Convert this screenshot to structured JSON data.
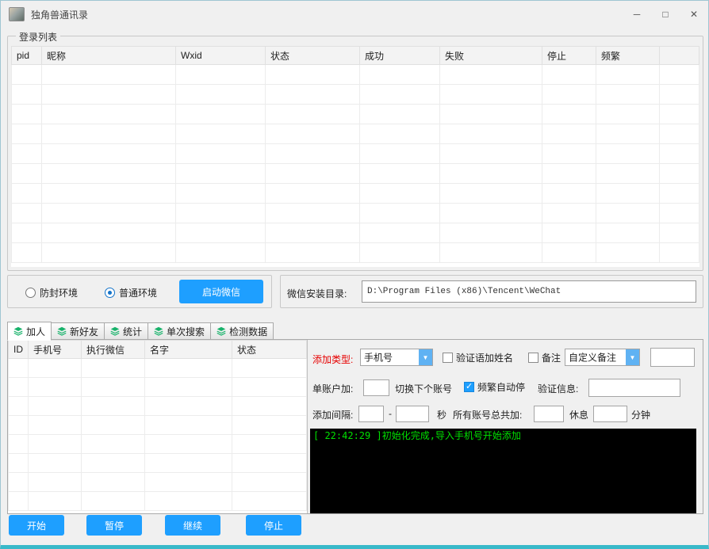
{
  "titlebar": {
    "title": "独角兽通讯录",
    "minimize": "─",
    "maximize": "□",
    "close": "✕"
  },
  "icons": {
    "dropdown_arrow": "▼",
    "check": "✓"
  },
  "login": {
    "group_title": "登录列表",
    "columns": [
      "pid",
      "昵称",
      "Wxid",
      "状态",
      "成功",
      "失败",
      "停止",
      "频繁"
    ]
  },
  "env": {
    "anti_ban": "防封环境",
    "normal": "普通环境",
    "selected": "普通环境",
    "start_button": "启动微信"
  },
  "install": {
    "label": "微信安装目录:",
    "path": "D:\\Program Files (x86)\\Tencent\\WeChat"
  },
  "tabs": [
    {
      "label": "加人",
      "active": true
    },
    {
      "label": "新好友",
      "active": false
    },
    {
      "label": "统计",
      "active": false
    },
    {
      "label": "单次搜索",
      "active": false
    },
    {
      "label": "检测数据",
      "active": false
    }
  ],
  "phone_table": {
    "columns": [
      "ID",
      "手机号",
      "执行微信",
      "名字",
      "状态"
    ]
  },
  "form": {
    "add_type_label": "添加类型:",
    "add_type_value": "手机号",
    "verify_with_name": "验证语加姓名",
    "remark": "备注",
    "remark_mode": "自定义备注",
    "custom_remark_value": "",
    "per_account_label": "单账户加:",
    "per_account_value": "",
    "switch_account": "切换下个账号",
    "auto_stop": "频繁自动停",
    "verify_msg_label": "验证信息:",
    "verify_msg_value": "",
    "interval_label": "添加间隔:",
    "interval_from": "",
    "interval_dash": "-",
    "interval_to": "",
    "seconds": "秒",
    "total_label": "所有账号总共加:",
    "total_value": "",
    "rest": "休息",
    "rest_value": "",
    "minutes": "分钟"
  },
  "console": {
    "lines": [
      "[ 22:42:29 ]初始化完成,导入手机号开始添加"
    ]
  },
  "actions": {
    "start": "开始",
    "pause": "暂停",
    "resume": "继续",
    "stop": "停止"
  }
}
